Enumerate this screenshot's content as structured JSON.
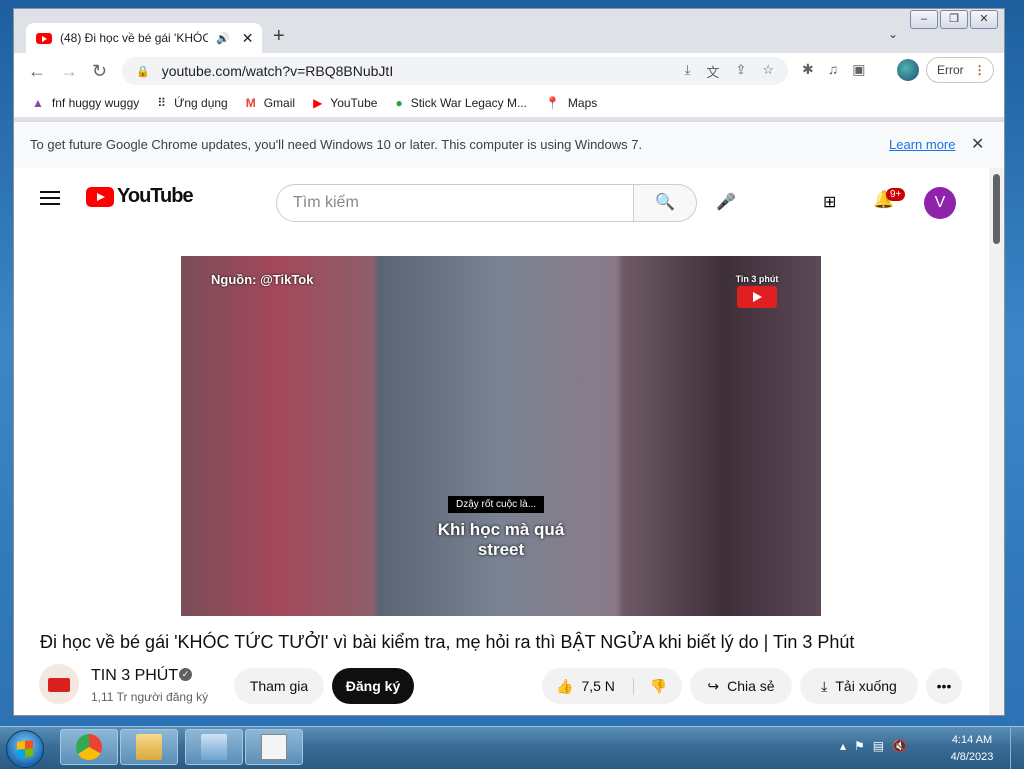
{
  "browser": {
    "tab_title": "(48) Đi học về bé gái 'KHÓC",
    "url": "youtube.com/watch?v=RBQ8BNubJtI",
    "profile_button": "Error",
    "bookmarks": [
      {
        "icon": "triangle-icon",
        "label": "fnf huggy wuggy"
      },
      {
        "icon": "apps-icon",
        "label": "Ứng dụng"
      },
      {
        "icon": "gmail-icon",
        "label": "Gmail"
      },
      {
        "icon": "youtube-icon",
        "label": "YouTube"
      },
      {
        "icon": "stickwar-icon",
        "label": "Stick War Legacy M..."
      },
      {
        "icon": "maps-icon",
        "label": "Maps"
      }
    ],
    "infobar": {
      "message": "To get future Google Chrome updates, you'll need Windows 10 or later. This computer is using Windows 7.",
      "link": "Learn more"
    }
  },
  "youtube": {
    "search_placeholder": "Tìm kiếm",
    "notification_count": "9+",
    "avatar_letter": "V",
    "video": {
      "overlay_source": "Nguồn: @TikTok",
      "overlay_channel": "Tin 3 phút",
      "caption_small": "Dzậy rốt cuộc là...",
      "caption_large": "Khi học mà quá street"
    },
    "title": "Đi học về bé gái 'KHÓC TỨC TƯỞI' vì bài kiểm tra, mẹ hỏi ra thì BẬT NGỬA khi biết lý do | Tin 3 Phút",
    "channel": {
      "name": "TIN 3 PHÚT",
      "subscribers": "1,11 Tr người đăng ký"
    },
    "buttons": {
      "join": "Tham gia",
      "subscribe": "Đăng ký",
      "likes": "7,5 N",
      "share": "Chia sẻ",
      "download": "Tải xuống"
    }
  },
  "taskbar": {
    "time": "4:14 AM",
    "date": "4/8/2023"
  },
  "colors": {
    "youtube_red": "#ff0000",
    "avatar_purple": "#8e24aa",
    "link_blue": "#1a73e8"
  }
}
